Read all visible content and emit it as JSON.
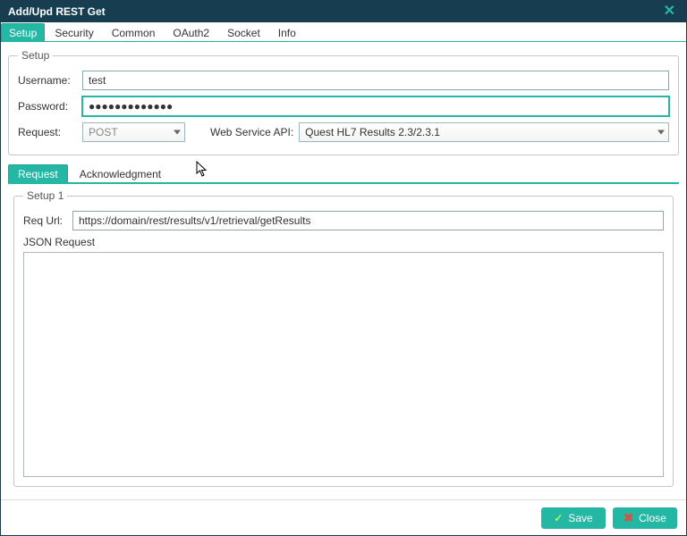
{
  "window": {
    "title": "Add/Upd REST Get"
  },
  "tabs": {
    "setup": "Setup",
    "security": "Security",
    "common": "Common",
    "oauth2": "OAuth2",
    "socket": "Socket",
    "info": "Info"
  },
  "setup": {
    "legend": "Setup",
    "username_label": "Username:",
    "username_value": "test",
    "password_label": "Password:",
    "password_value": "●●●●●●●●●●●●●",
    "request_label": "Request:",
    "request_value": "POST",
    "webapi_label": "Web Service API:",
    "webapi_value": "Quest HL7 Results 2.3/2.3.1"
  },
  "subtabs": {
    "request": "Request",
    "ack": "Acknowledgment"
  },
  "setup1": {
    "legend": "Setup 1",
    "requrl_label": "Req Url:",
    "requrl_value": "https://domain/rest/results/v1/retrieval/getResults",
    "json_label": "JSON Request",
    "json_value": ""
  },
  "footer": {
    "save": "Save",
    "close": "Close"
  }
}
